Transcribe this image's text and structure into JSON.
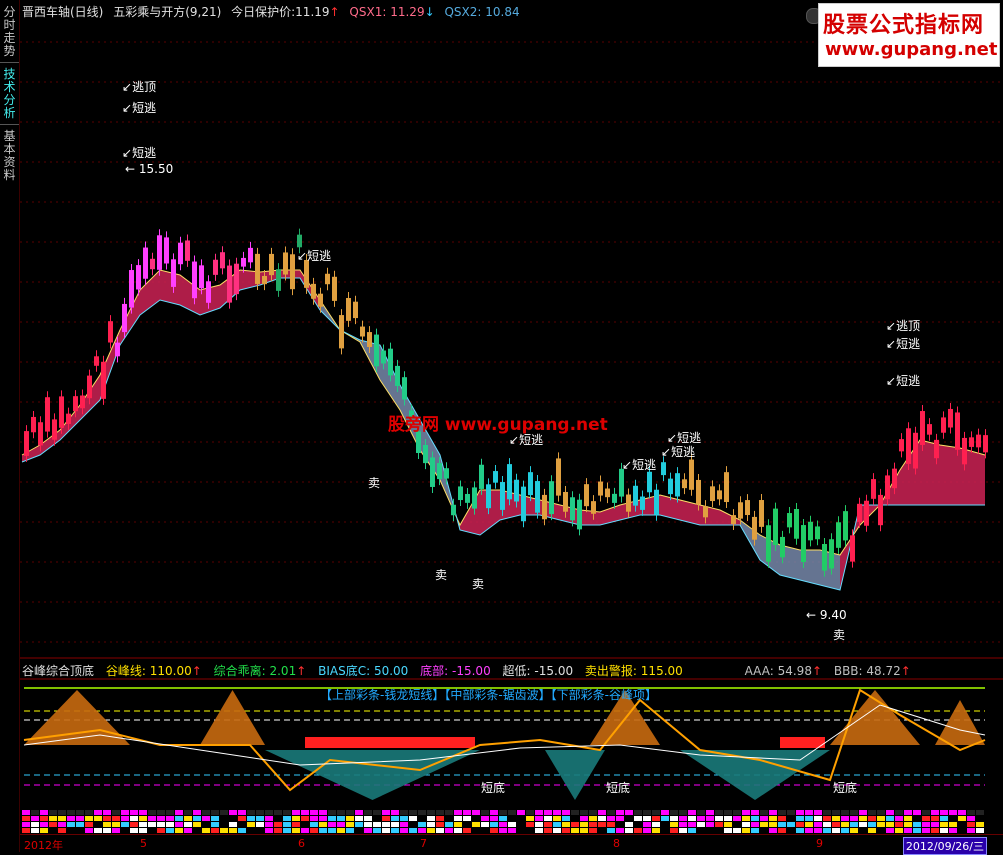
{
  "sidebar": {
    "tabs": [
      {
        "label": "分时走势"
      },
      {
        "label": "技术分析"
      },
      {
        "label": "基本资料"
      }
    ]
  },
  "header": {
    "stock_name": "晋西车轴(日线)",
    "indicator": "五彩乘与开方(9,21)",
    "protect_label": "今日保护价:",
    "protect_value": "11.19",
    "qsx1_label": "QSX1:",
    "qsx1_value": "11.29",
    "qsx2_label": "QSX2:",
    "qsx2_value": "10.84"
  },
  "watermark": {
    "title": "股票公式指标网",
    "url": "www.gupang.net",
    "center": "股旁网 www.gupang.net"
  },
  "annotations": {
    "escape_top": "逃顶",
    "short_escape": "短逃",
    "sell": "卖",
    "high_value": "15.50",
    "low_value": "9.40",
    "short_bottom": "短底"
  },
  "lower_indicator": {
    "name": "谷峰综合顶底",
    "items": [
      {
        "label": "谷峰线:",
        "value": "110.00",
        "color": "#ffe000"
      },
      {
        "label": "综合乖离:",
        "value": "2.01",
        "color": "#22e04a"
      },
      {
        "label": "BIAS底C:",
        "value": "50.00",
        "color": "#4ad8ff"
      },
      {
        "label": "底部:",
        "value": "-15.00",
        "color": "#ff40ff"
      },
      {
        "label": "超低:",
        "value": "-15.00",
        "color": "#e0e0e0"
      },
      {
        "label": "卖出警报:",
        "value": "115.00",
        "color": "#ffe000"
      },
      {
        "label": "AAA:",
        "value": "54.98",
        "color": "#c0c0c0"
      },
      {
        "label": "BBB:",
        "value": "48.72",
        "color": "#c0c0c0"
      }
    ],
    "banner": "【上部彩条-钱龙短线】【中部彩条-锯齿波】【下部彩条-谷峰项】"
  },
  "date_axis": {
    "labels": [
      "2012年",
      "5",
      "6",
      "7",
      "8",
      "9"
    ],
    "current_date": "2012/09/26/三"
  },
  "colors": {
    "up": "#ff2050",
    "down": "#22ccdd",
    "cloud_red": "#cc2255",
    "cloud_gray": "#7788aa",
    "background": "#000000"
  }
}
